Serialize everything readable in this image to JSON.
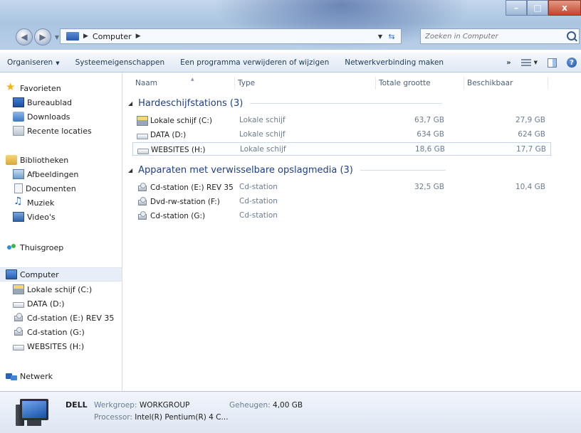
{
  "window": {
    "minimize_label": "–",
    "maximize_label": "□",
    "close_label": "x"
  },
  "address": {
    "crumbs": [
      "Computer"
    ],
    "search_placeholder": "Zoeken in Computer"
  },
  "commandbar": {
    "items": [
      "Organiseren",
      "Systeemeigenschappen",
      "Een programma verwijderen of wijzigen",
      "Netwerkverbinding maken"
    ],
    "more_label": "»",
    "help_label": "?"
  },
  "nav": {
    "favorites": {
      "label": "Favorieten",
      "items": [
        "Bureaublad",
        "Downloads",
        "Recente locaties"
      ]
    },
    "libraries": {
      "label": "Bibliotheken",
      "items": [
        "Afbeeldingen",
        "Documenten",
        "Muziek",
        "Video's"
      ]
    },
    "homegroup": {
      "label": "Thuisgroep"
    },
    "computer": {
      "label": "Computer",
      "items": [
        "Lokale schijf (C:)",
        "DATA (D:)",
        "Cd-station (E:) REV 35",
        "Cd-station (G:)",
        "WEBSITES (H:)"
      ]
    },
    "network": {
      "label": "Netwerk"
    }
  },
  "columns": [
    "Naam",
    "Type",
    "Totale grootte",
    "Beschikbaar"
  ],
  "groups": [
    {
      "title": "Hardeschijfstations (3)",
      "rows": [
        {
          "name": "Lokale schijf (C:)",
          "type": "Lokale schijf",
          "total": "63,7 GB",
          "free": "27,9 GB",
          "icon": "system-drive-icon"
        },
        {
          "name": "DATA (D:)",
          "type": "Lokale schijf",
          "total": "634 GB",
          "free": "624 GB",
          "icon": "hard-drive-icon"
        },
        {
          "name": "WEBSITES (H:)",
          "type": "Lokale schijf",
          "total": "18,6 GB",
          "free": "17,7 GB",
          "icon": "hard-drive-icon",
          "selected": true
        }
      ]
    },
    {
      "title": "Apparaten met verwisselbare opslagmedia (3)",
      "rows": [
        {
          "name": "Cd-station (E:) REV 35",
          "type": "Cd-station",
          "total": "32,5 GB",
          "free": "10,4 GB",
          "icon": "cd-drive-icon"
        },
        {
          "name": "Dvd-rw-station (F:)",
          "type": "Cd-station",
          "total": "",
          "free": "",
          "icon": "dvd-drive-icon"
        },
        {
          "name": "Cd-station (G:)",
          "type": "Cd-station",
          "total": "",
          "free": "",
          "icon": "cd-drive-icon"
        }
      ]
    }
  ],
  "details": {
    "name": "DELL",
    "workgroup_label": "Werkgroep:",
    "workgroup_value": "WORKGROUP",
    "memory_label": "Geheugen:",
    "memory_value": "4,00 GB",
    "processor_label": "Processor:",
    "processor_value": "Intel(R) Pentium(R) 4 C..."
  }
}
